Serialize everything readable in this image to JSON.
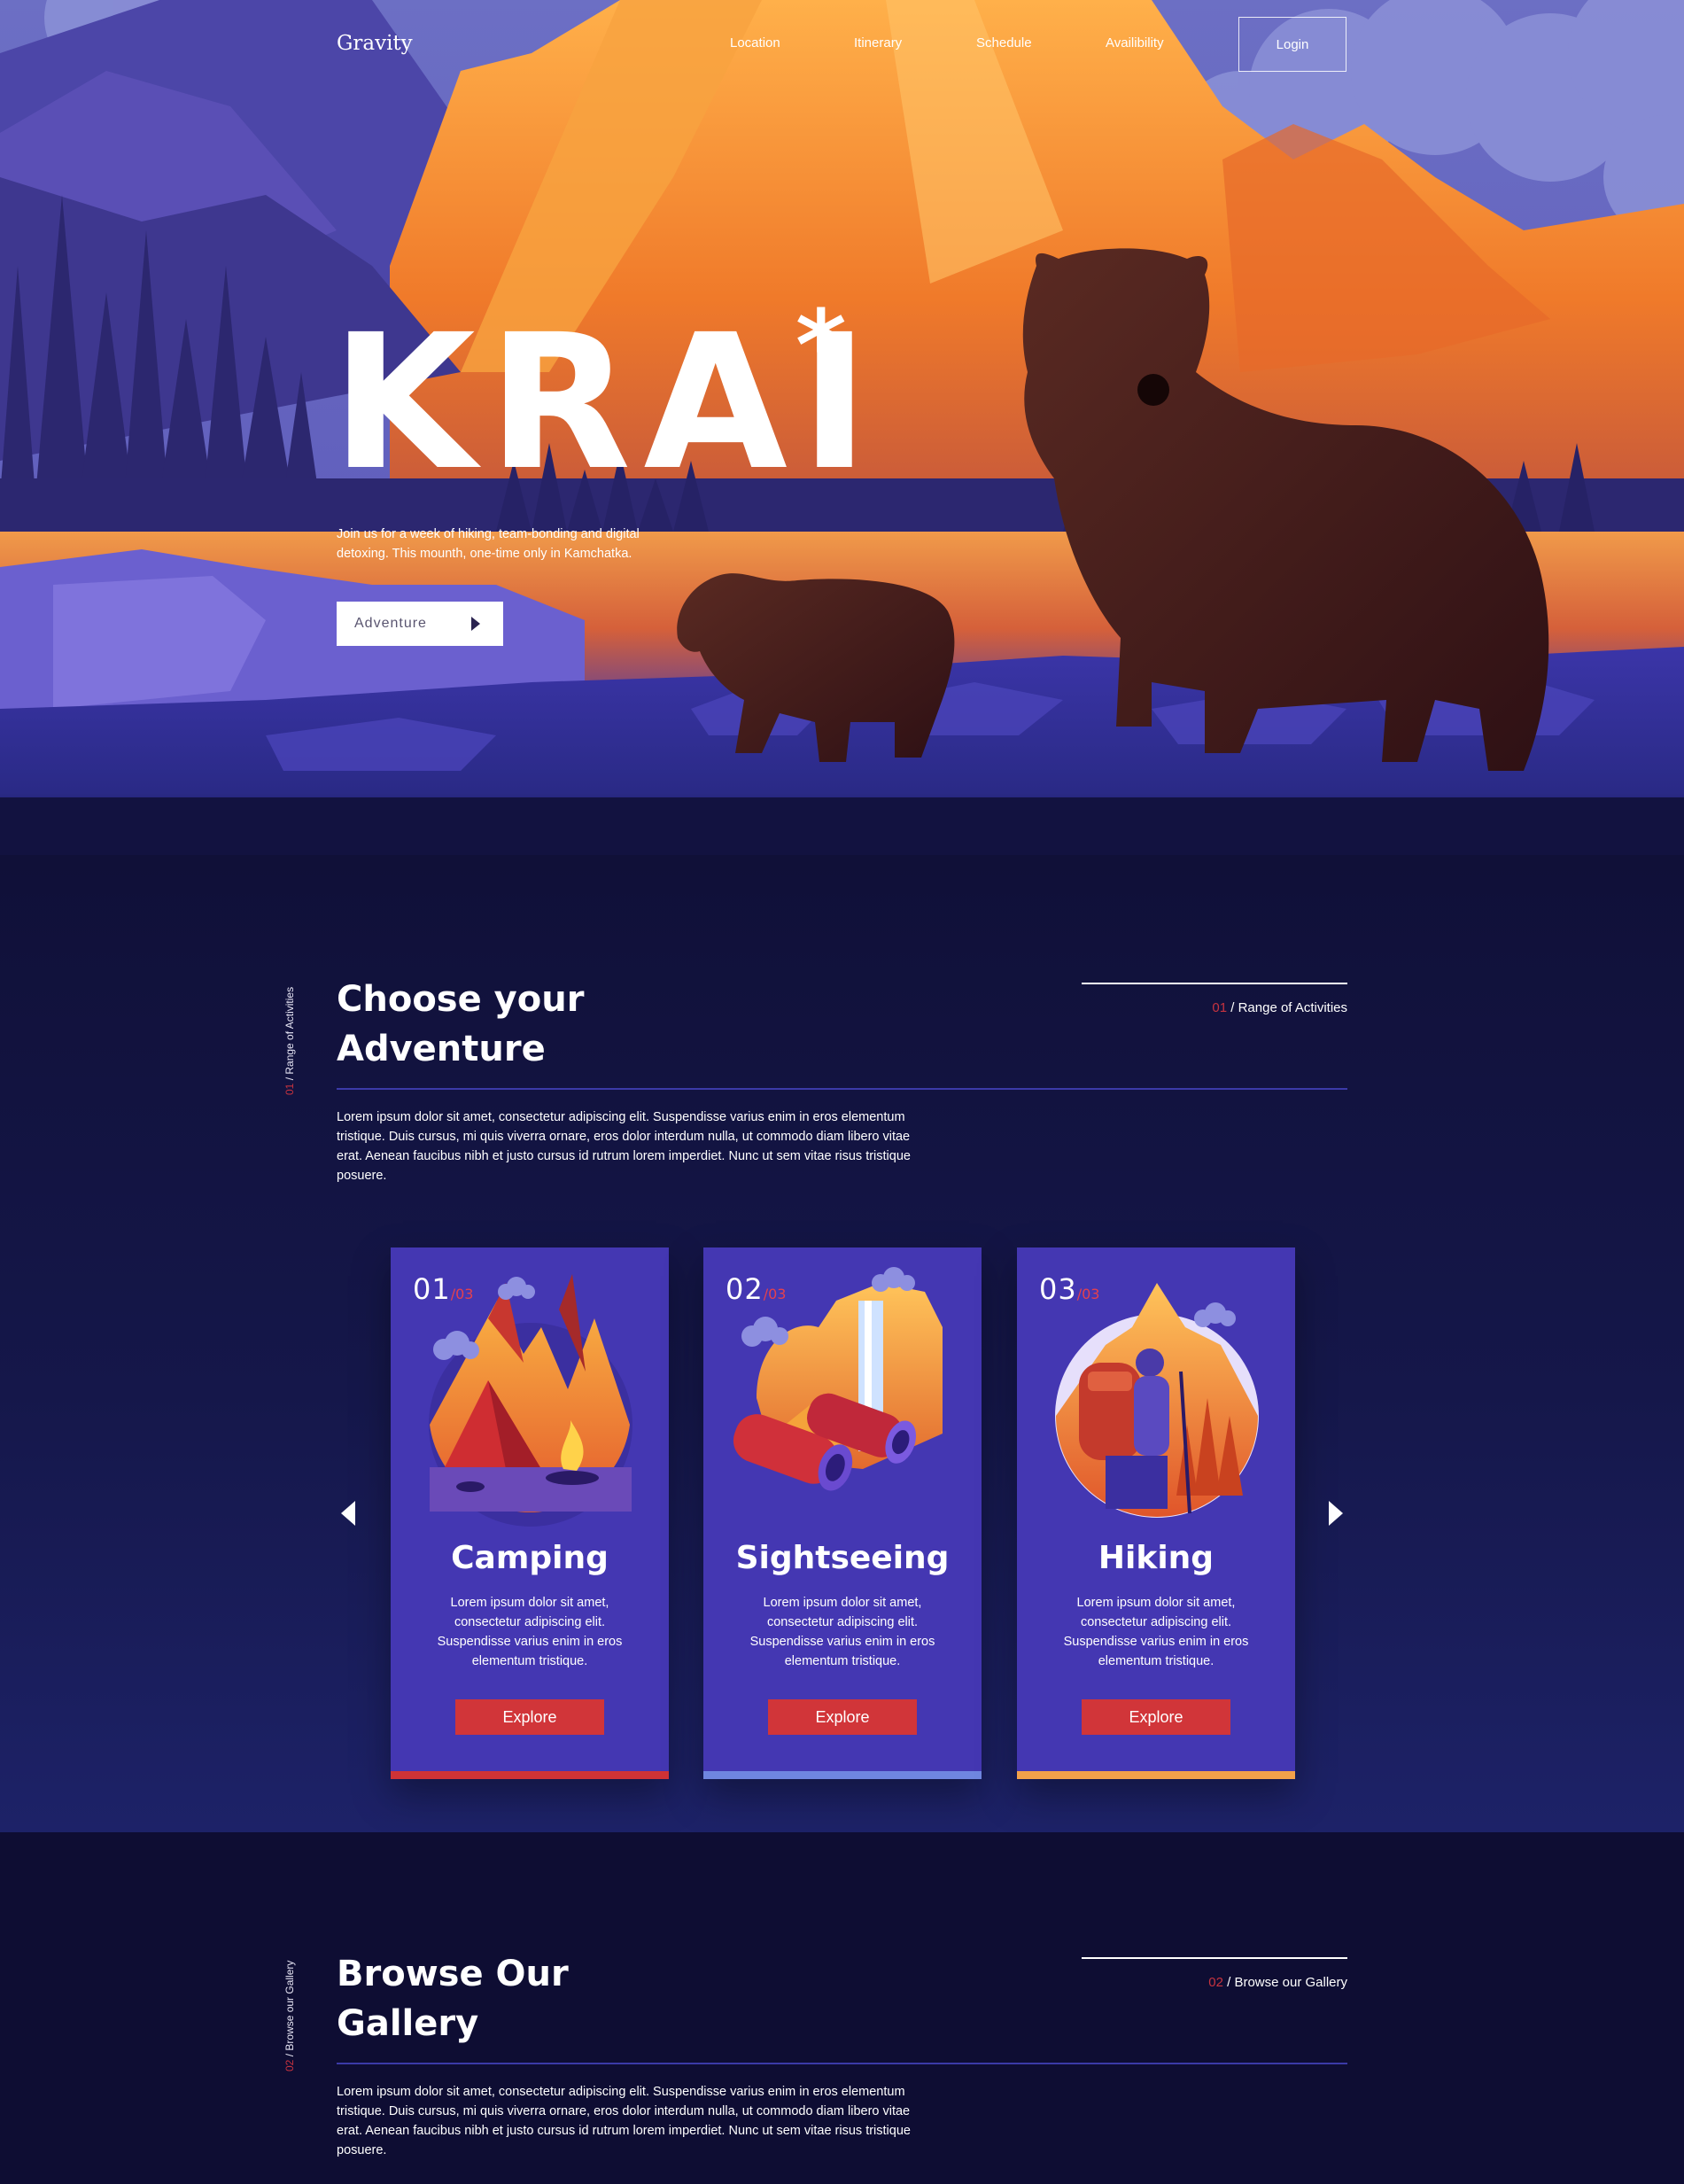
{
  "nav": {
    "logo": "Gravity",
    "links": [
      "Location",
      "Itinerary",
      "Schedule",
      "Availibility"
    ],
    "login_label": "Login"
  },
  "hero": {
    "title": "KRAI",
    "asterisk": "*",
    "subtitle": "Join us for a week of hiking, team-bonding and digital detoxing. This mounth, one-time only in Kamchatka.",
    "button_label": "Adventure"
  },
  "activities": {
    "side_label_num": "01",
    "side_label_text": " / Range of Activities",
    "title_line1": "Choose your",
    "title_line2": "Adventure",
    "crumb_num": "01",
    "crumb_text": " / Range of Activities",
    "body": "Lorem ipsum dolor sit amet, consectetur adipiscing elit. Suspendisse varius enim in eros elementum tristique. Duis cursus, mi quis viverra ornare, eros dolor interdum nulla, ut commodo diam libero vitae erat. Aenean faucibus nibh et justo cursus id rutrum lorem imperdiet. Nunc ut sem vitae risus tristique posuere.",
    "cards": [
      {
        "num": "01",
        "total": "/03",
        "title": "Camping",
        "desc": "Lorem ipsum dolor sit amet, consectetur adipiscing elit. Suspendisse varius enim in eros elementum tristique.",
        "button": "Explore",
        "bar_color": "#cf3336"
      },
      {
        "num": "02",
        "total": "/03",
        "title": "Sightseeing",
        "desc": "Lorem ipsum dolor sit amet, consectetur adipiscing elit. Suspendisse varius enim in eros elementum tristique.",
        "button": "Explore",
        "bar_color": "#6f86e0"
      },
      {
        "num": "03",
        "total": "/03",
        "title": "Hiking",
        "desc": "Lorem ipsum dolor sit amet, consectetur adipiscing elit. Suspendisse varius enim in eros elementum tristique.",
        "button": "Explore",
        "bar_color": "#f3a14a"
      }
    ]
  },
  "gallery": {
    "side_label_num": "02",
    "side_label_text": " / Browse our Gallery",
    "title_line1": "Browse Our",
    "title_line2": "Gallery",
    "crumb_num": "02",
    "crumb_text": " / Browse our Gallery",
    "body": "Lorem ipsum dolor sit amet, consectetur adipiscing elit. Suspendisse varius enim in eros elementum tristique. Duis cursus, mi quis viverra ornare, eros dolor interdum nulla, ut commodo diam libero vitae erat. Aenean faucibus nibh et justo cursus id rutrum lorem imperdiet. Nunc ut sem vitae risus tristique posuere."
  }
}
